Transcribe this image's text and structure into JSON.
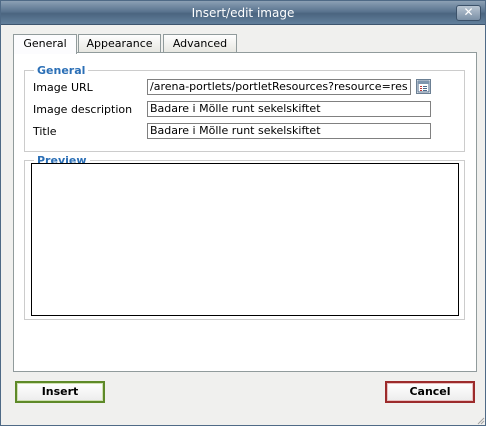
{
  "window": {
    "title": "Insert/edit image",
    "close_label": "✕"
  },
  "tabs": [
    {
      "label": "General",
      "active": true
    },
    {
      "label": "Appearance",
      "active": false
    },
    {
      "label": "Advanced",
      "active": false
    }
  ],
  "general": {
    "legend": "General",
    "fields": {
      "image_url": {
        "label": "Image URL",
        "value": "/arena-portlets/portletResources?resource=res"
      },
      "image_description": {
        "label": "Image description",
        "value": "Badare i Mölle runt sekelskiftet"
      },
      "title": {
        "label": "Title",
        "value": "Badare i Mölle runt sekelskiftet"
      }
    },
    "browse_icon": "file-browser-icon"
  },
  "preview": {
    "legend": "Preview"
  },
  "buttons": {
    "insert_label": "Insert",
    "cancel_label": "Cancel"
  },
  "colors": {
    "legend": "#2b6fb6",
    "insert_border": "#5e8a28",
    "cancel_border": "#9c2b2b",
    "titlebar": "#5b7590"
  }
}
